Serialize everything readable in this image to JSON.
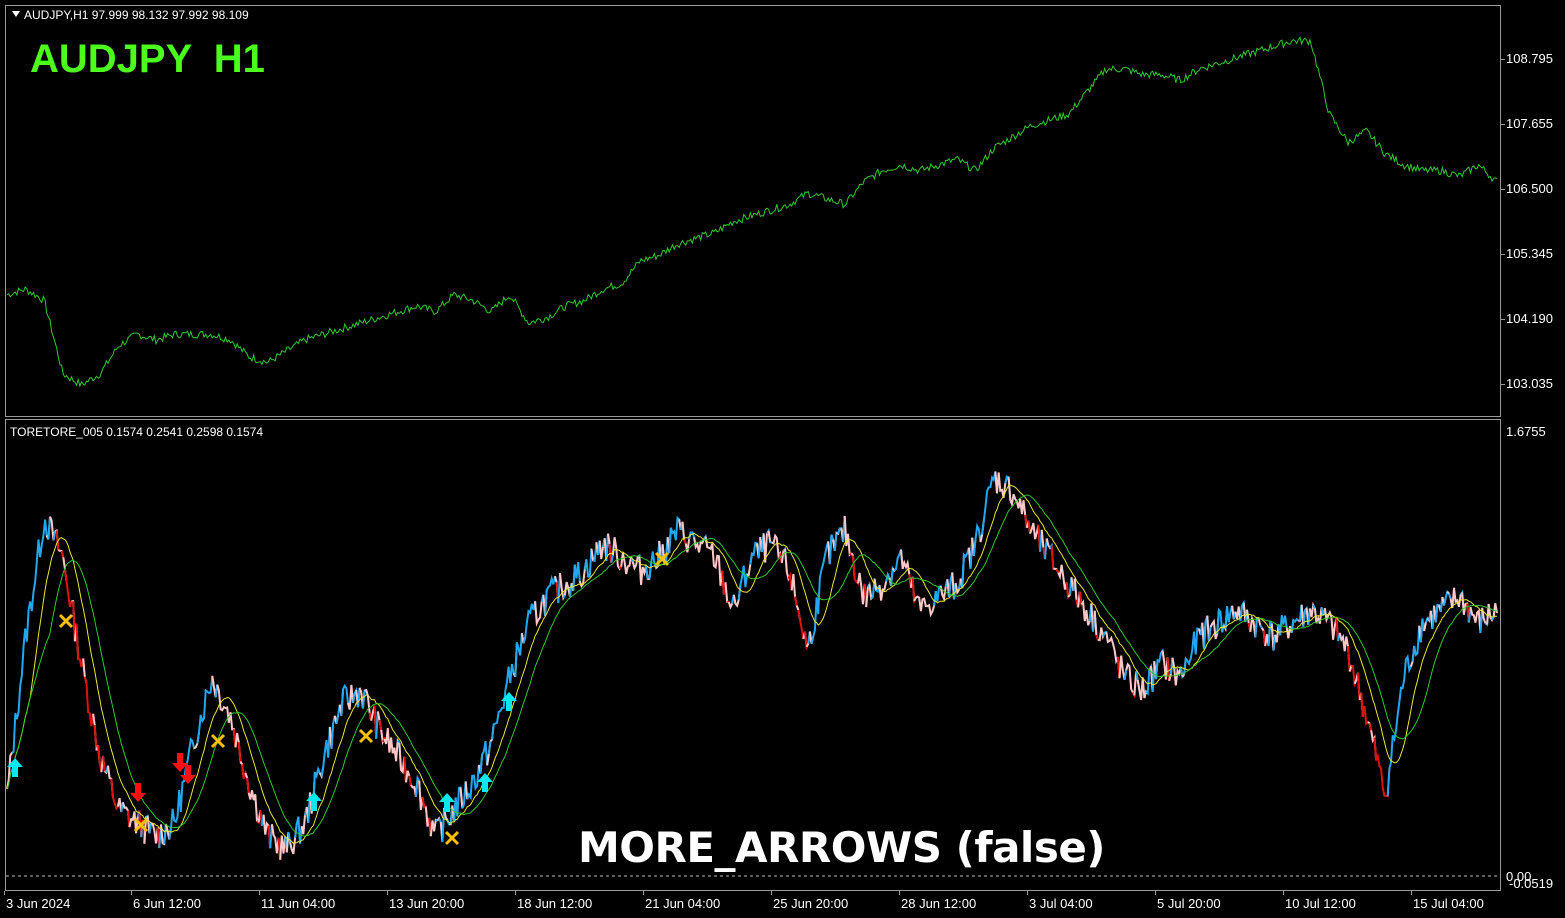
{
  "main_chart": {
    "header": "AUDJPY,H1  97.999 98.132 97.992 98.109",
    "overlay_title": "AUDJPY  H1",
    "price_axis": [
      "108.795",
      "107.655",
      "106.500",
      "105.345",
      "104.190",
      "103.035"
    ],
    "line_color": "#32c832",
    "title_color": "#4cfc1c"
  },
  "indicator": {
    "header": "TORETORE_005 0.1574 0.2541 0.2598 0.1574",
    "scale_labels": [
      "1.6755",
      "0.00",
      "-0.0519"
    ],
    "overlay_caption": "MORE_ARROWS (false)",
    "colors": {
      "up": "#22a8f0",
      "down": "#e01010",
      "light": "#ffc8c8",
      "ma1": "#e8e830",
      "ma2": "#30c830",
      "arrow_up": "#00e8f0",
      "arrow_down": "#ff1010",
      "cross": "#ffc000"
    }
  },
  "time_axis": [
    "3 Jun 2024",
    "6 Jun 12:00",
    "11 Jun 04:00",
    "13 Jun 20:00",
    "18 Jun 12:00",
    "21 Jun 04:00",
    "25 Jun 20:00",
    "28 Jun 12:00",
    "3 Jul 04:00",
    "5 Jul 20:00",
    "10 Jul 12:00",
    "15 Jul 04:00"
  ],
  "price_series": [
    104.6,
    104.7,
    104.5,
    103.2,
    103.0,
    103.2,
    103.7,
    103.9,
    103.8,
    103.9,
    103.9,
    103.9,
    103.8,
    103.5,
    103.4,
    103.6,
    103.8,
    103.9,
    104.0,
    104.1,
    104.2,
    104.3,
    104.4,
    104.3,
    104.6,
    104.5,
    104.3,
    104.6,
    104.1,
    104.2,
    104.4,
    104.5,
    104.7,
    104.8,
    105.2,
    105.3,
    105.5,
    105.6,
    105.7,
    105.9,
    106.0,
    106.1,
    106.2,
    106.4,
    106.3,
    106.2,
    106.6,
    106.8,
    106.9,
    106.8,
    106.9,
    107.0,
    106.8,
    107.2,
    107.4,
    107.6,
    107.7,
    107.8,
    108.2,
    108.6,
    108.6,
    108.5,
    108.5,
    108.4,
    108.6,
    108.7,
    108.8,
    108.9,
    109.0,
    109.1,
    109.1,
    107.8,
    107.3,
    107.5,
    107.1,
    106.9,
    106.8,
    106.8,
    106.7,
    106.9,
    106.6
  ]
}
